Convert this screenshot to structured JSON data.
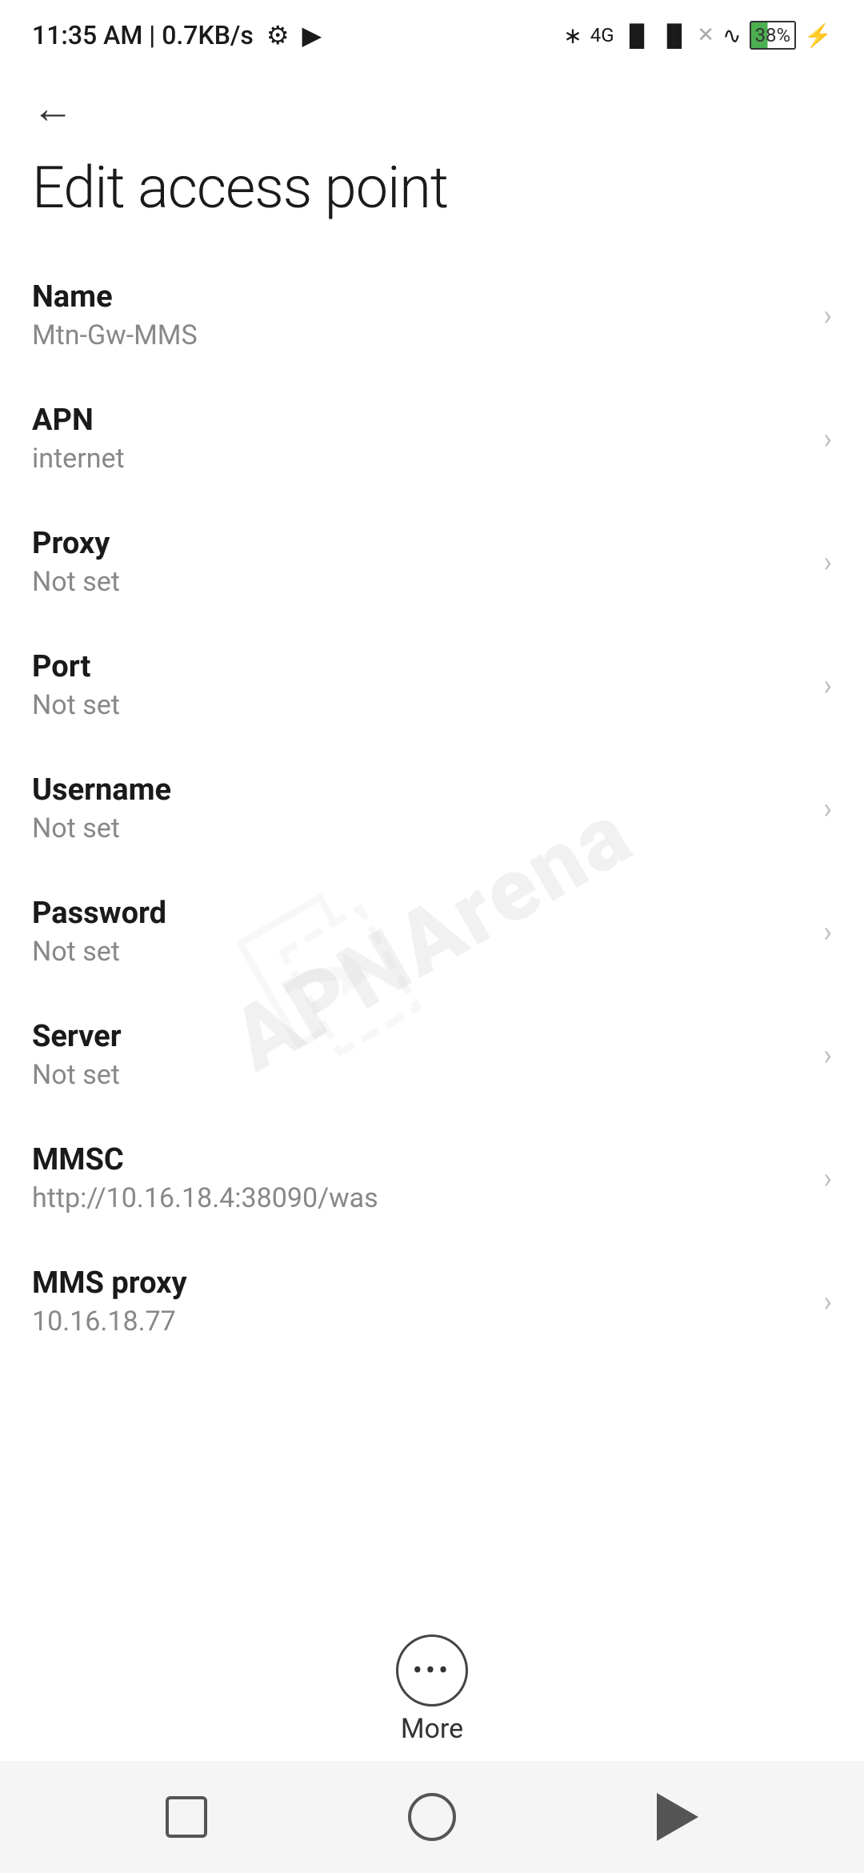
{
  "statusBar": {
    "time": "11:35 AM | 0.7KB/s",
    "battery": "38"
  },
  "navigation": {
    "backLabel": "←"
  },
  "pageTitle": "Edit access point",
  "listItems": [
    {
      "id": "name",
      "title": "Name",
      "value": "Mtn-Gw-MMS"
    },
    {
      "id": "apn",
      "title": "APN",
      "value": "internet"
    },
    {
      "id": "proxy",
      "title": "Proxy",
      "value": "Not set"
    },
    {
      "id": "port",
      "title": "Port",
      "value": "Not set"
    },
    {
      "id": "username",
      "title": "Username",
      "value": "Not set"
    },
    {
      "id": "password",
      "title": "Password",
      "value": "Not set"
    },
    {
      "id": "server",
      "title": "Server",
      "value": "Not set"
    },
    {
      "id": "mmsc",
      "title": "MMSC",
      "value": "http://10.16.18.4:38090/was"
    },
    {
      "id": "mms-proxy",
      "title": "MMS proxy",
      "value": "10.16.18.77"
    }
  ],
  "more": {
    "label": "More"
  },
  "watermark": "APNArena"
}
